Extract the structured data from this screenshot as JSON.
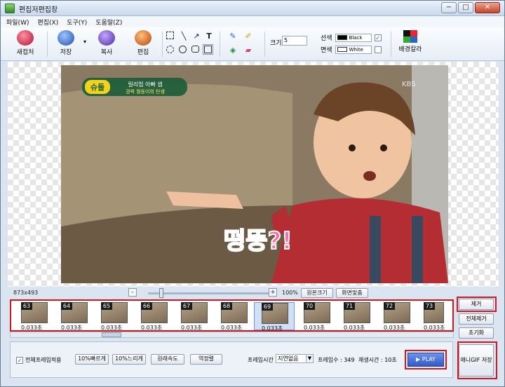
{
  "window": {
    "title": "편집저편집창",
    "min": "−",
    "max": "□",
    "close": "✕"
  },
  "menu": [
    "파일(W)",
    "편집(X)",
    "도구(Y)",
    "도움말(Z)"
  ],
  "toolbar": {
    "new": "새컵처",
    "save": "저장",
    "copy": "복사",
    "edit": "편집",
    "size_label": "크기",
    "size_value": "5",
    "line_label": "선색",
    "line_color_name": "Black",
    "fill_label": "면색",
    "fill_color_name": "White",
    "bg_color": "배경칼라",
    "text_tool": "T"
  },
  "status": {
    "dimensions": "873x493",
    "zoom": "100%",
    "original_size": "원본크기",
    "fit_screen": "화면맞춤",
    "zoom_out": "-",
    "zoom_in": "+"
  },
  "frames": [
    {
      "num": "63",
      "dur": "0.033초"
    },
    {
      "num": "64",
      "dur": "0.033초"
    },
    {
      "num": "65",
      "dur": "0.033초"
    },
    {
      "num": "66",
      "dur": "0.033초"
    },
    {
      "num": "67",
      "dur": "0.033초"
    },
    {
      "num": "68",
      "dur": "0.033초"
    },
    {
      "num": "69",
      "dur": "0.033초"
    },
    {
      "num": "70",
      "dur": "0.033초"
    },
    {
      "num": "71",
      "dur": "0.033초"
    },
    {
      "num": "72",
      "dur": "0.033초"
    },
    {
      "num": "73",
      "dur": "0.033초"
    }
  ],
  "side": {
    "remove": "제거",
    "remove_all": "전체제거",
    "reset": "초기화",
    "save_gif": "애니GIF 저장"
  },
  "bottom": {
    "apply_all": "전체프레임적용",
    "faster": "10%빠르게",
    "slower": "10%느리게",
    "original_speed": "원래속도",
    "reverse": "역정렬",
    "frame_time_label": "프레임시간",
    "frame_time_value": "지연없음",
    "frame_count": "프레임수 : 349",
    "play_time": "재생시간 : 10초",
    "play": "▶ PLAY"
  },
  "overlay": {
    "logo": "슈돌",
    "subtitle_top": "릴리업 아빠 샘",
    "subtitle_bottom": "경력 월동이의 탄생",
    "caption": "떵뚱?!",
    "broadcaster": "KBS"
  }
}
